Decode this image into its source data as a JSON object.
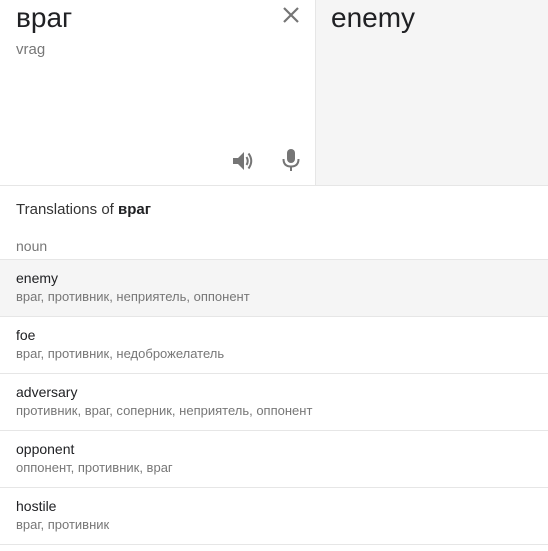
{
  "source": {
    "text": "враг",
    "transliteration": "vrag"
  },
  "target": {
    "text": "enemy"
  },
  "icons": {
    "clear": "close-icon",
    "speaker": "speaker-icon",
    "mic": "microphone-icon"
  },
  "translations": {
    "heading_prefix": "Translations of",
    "heading_word": "враг",
    "part_of_speech": "noun",
    "entries": [
      {
        "word": "enemy",
        "synonyms": "враг, противник, неприятель, оппонент"
      },
      {
        "word": "foe",
        "synonyms": "враг, противник, недоброжелатель"
      },
      {
        "word": "adversary",
        "synonyms": "противник, враг, соперник, неприятель, оппонент"
      },
      {
        "word": "opponent",
        "synonyms": "оппонент, противник, враг"
      },
      {
        "word": "hostile",
        "synonyms": "враг, противник"
      }
    ]
  },
  "colors": {
    "icon": "#757575",
    "highlight": "#f5f5f5",
    "divider": "#e6e6e6"
  }
}
